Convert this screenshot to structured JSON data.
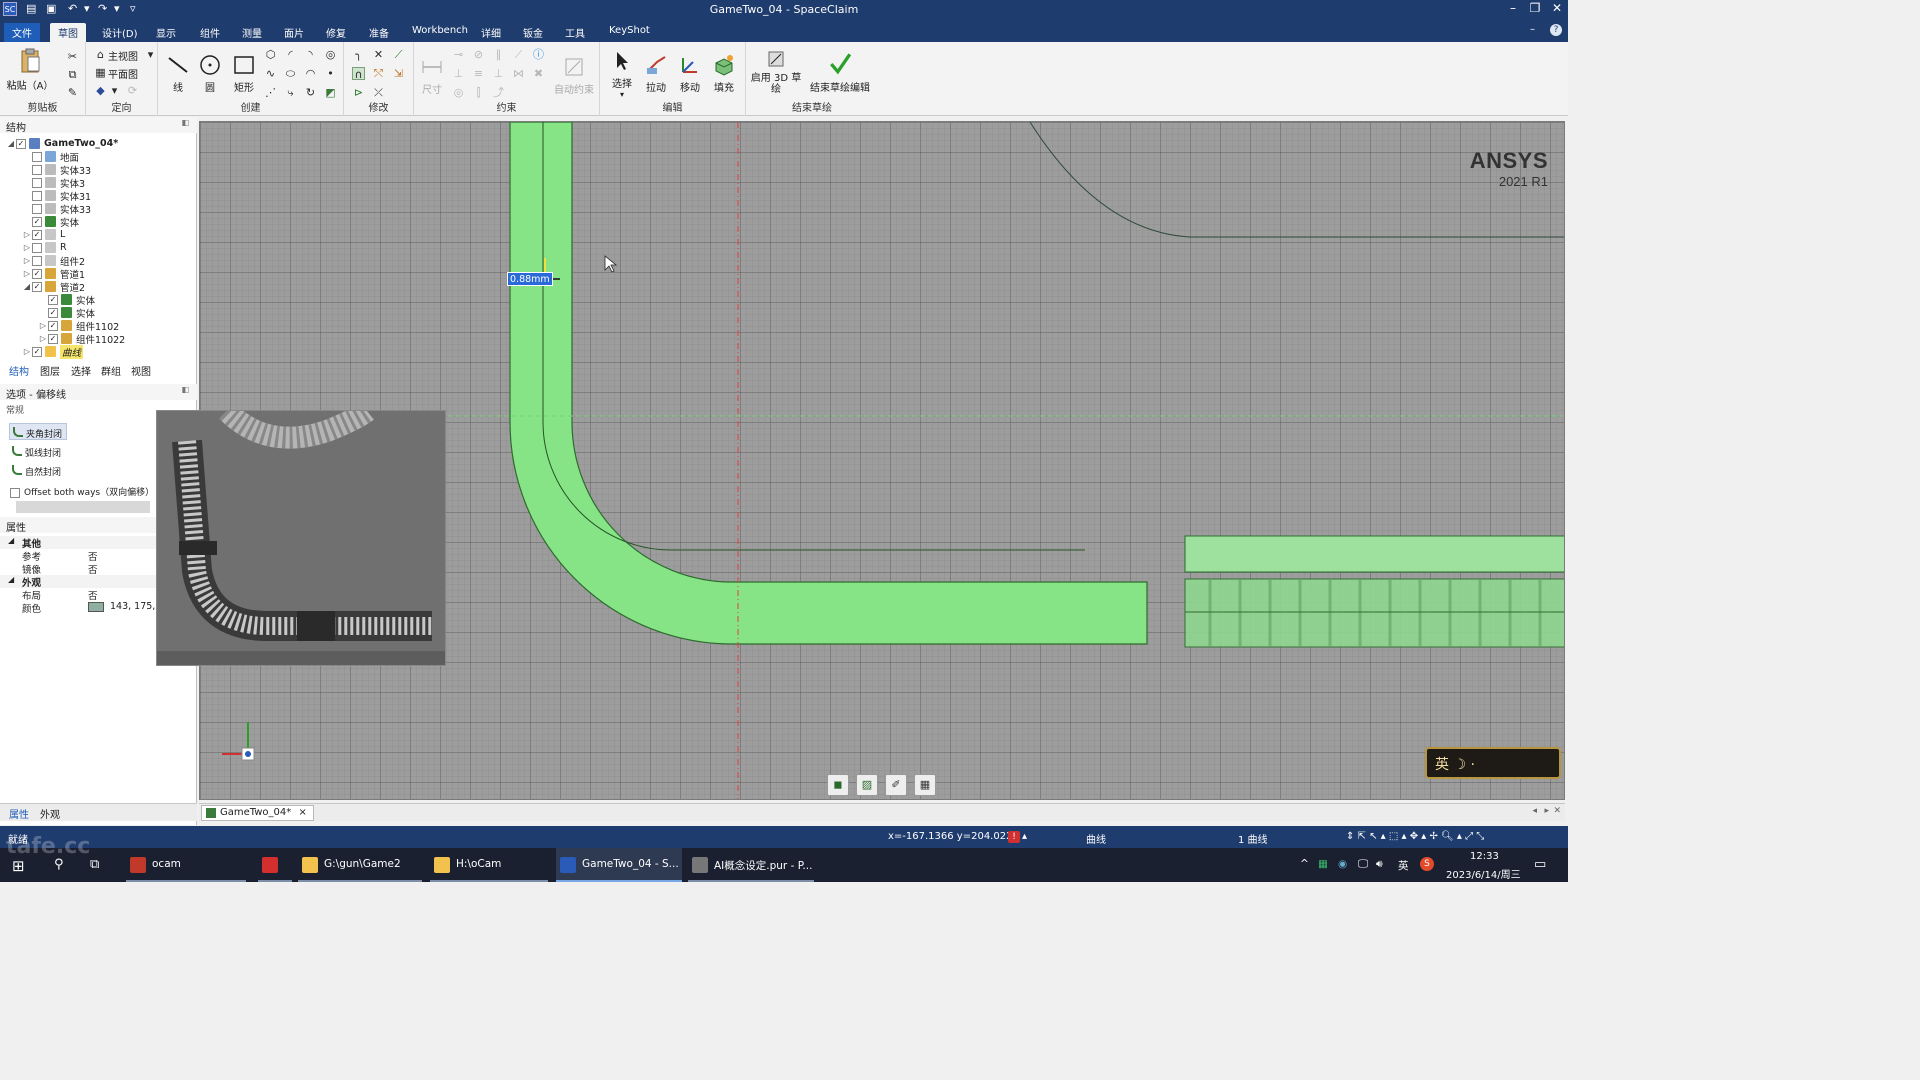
{
  "window": {
    "title": "GameTwo_04 - SpaceClaim",
    "app_icon": "SC",
    "controls": {
      "minimize": "–",
      "restore": "❐",
      "close": "✕"
    }
  },
  "menu_tabs": [
    "文件",
    "草图",
    "设计(D)",
    "显示",
    "组件",
    "测量",
    "面片",
    "修复",
    "准备",
    "Workbench",
    "详细",
    "钣金",
    "工具",
    "KeyShot"
  ],
  "ribbon": {
    "clipboard": {
      "paste": "粘贴（A）",
      "group": "剪贴板"
    },
    "orient": {
      "home_view": "主视图",
      "plan_view": "平面图",
      "group": "定向"
    },
    "create": {
      "line": "线",
      "circle": "圆",
      "rect": "矩形",
      "group": "创建"
    },
    "modify": {
      "group": "修改"
    },
    "constrain": {
      "dimension": "尺寸",
      "auto": "自动约束",
      "group": "约束"
    },
    "edit": {
      "select": "选择",
      "pull": "拉动",
      "move": "移动",
      "fill": "填充",
      "group": "编辑"
    },
    "end_sketch": {
      "enable_3d": "启用 3D 草绘",
      "finish": "结束草绘编辑",
      "group": "结束草绘"
    }
  },
  "structure": {
    "header": "结构",
    "tree": [
      {
        "label": "GameTwo_04*",
        "level": 0,
        "expander": "◢",
        "checked": true,
        "icon": "root-icon",
        "bold": true
      },
      {
        "label": "地面",
        "level": 1,
        "expander": "",
        "checked": false,
        "icon": "ground-icon"
      },
      {
        "label": "实体33",
        "level": 1,
        "expander": "",
        "checked": false,
        "icon": "solid-grey-icon"
      },
      {
        "label": "实体3",
        "level": 1,
        "expander": "",
        "checked": false,
        "icon": "solid-grey-icon"
      },
      {
        "label": "实体31",
        "level": 1,
        "expander": "",
        "checked": false,
        "icon": "solid-grey-icon"
      },
      {
        "label": "实体33",
        "level": 1,
        "expander": "",
        "checked": false,
        "icon": "solid-grey-icon"
      },
      {
        "label": "实体",
        "level": 1,
        "expander": "",
        "checked": true,
        "icon": "solid-icon"
      },
      {
        "label": "L",
        "level": 1,
        "expander": "▷",
        "checked": true,
        "icon": "component-grey-icon"
      },
      {
        "label": "R",
        "level": 1,
        "expander": "▷",
        "checked": false,
        "icon": "component-grey-icon"
      },
      {
        "label": "组件2",
        "level": 1,
        "expander": "▷",
        "checked": false,
        "icon": "component-grey-icon"
      },
      {
        "label": "管道1",
        "level": 1,
        "expander": "▷",
        "checked": true,
        "icon": "component-icon"
      },
      {
        "label": "管道2",
        "level": 1,
        "expander": "◢",
        "checked": true,
        "icon": "component-icon"
      },
      {
        "label": "实体",
        "level": 2,
        "expander": "",
        "checked": true,
        "icon": "solid-icon"
      },
      {
        "label": "实体",
        "level": 2,
        "expander": "",
        "checked": true,
        "icon": "solid-icon"
      },
      {
        "label": "组件1102",
        "level": 2,
        "expander": "▷",
        "checked": true,
        "icon": "component-icon"
      },
      {
        "label": "组件11022",
        "level": 2,
        "expander": "▷",
        "checked": true,
        "icon": "component-icon"
      },
      {
        "label": "曲线",
        "level": 1,
        "expander": "▷",
        "checked": true,
        "icon": "folder-icon",
        "highlight": true
      }
    ],
    "tabs": [
      "结构",
      "图层",
      "选择",
      "群组",
      "视图"
    ]
  },
  "options": {
    "header": "选项 - 偏移线",
    "section": "常规",
    "buttons": [
      "夹角封闭",
      "弧线封闭",
      "自然封闭"
    ],
    "checkbox_label": "Offset both ways（双向偏移）"
  },
  "properties": {
    "header": "属性",
    "rows": [
      {
        "key": "其他",
        "value": "",
        "category": true
      },
      {
        "key": "参考",
        "value": "否"
      },
      {
        "key": "镜像",
        "value": "否"
      },
      {
        "key": "外观",
        "value": "",
        "category": true
      },
      {
        "key": "布局",
        "value": "否"
      },
      {
        "key": "颜色",
        "value": "143, 175, 1",
        "swatch": "#8fafa0"
      }
    ],
    "bottom_tabs": [
      "属性",
      "外观"
    ]
  },
  "viewport": {
    "logo_line1": "ANSYS",
    "logo_line2": "2021 R1",
    "dimension_value": "0.88mm",
    "ime_badge": "英 ☽ ·",
    "accent_pipe": "#7fe07f",
    "accent_pipe_edge": "#2f6b2f"
  },
  "doc_tab": {
    "label": "GameTwo_04*",
    "close": "×"
  },
  "status": {
    "ready": "就绪",
    "coords": "x=-167.1366  y=204.0226",
    "mode": "曲线",
    "selection": "1 曲线"
  },
  "taskbar": {
    "items": [
      {
        "label": "ocam",
        "icon_color": "#c0392b"
      },
      {
        "label": "",
        "icon_color": "#d32f2f"
      },
      {
        "label": "G:\\gun\\Game2",
        "icon_color": "#f2c14e"
      },
      {
        "label": "H:\\oCam",
        "icon_color": "#f2c14e"
      },
      {
        "label": "GameTwo_04 - S...",
        "icon_color": "#2a5bb8"
      },
      {
        "label": "AI概念设定.pur - P...",
        "icon_color": "#777777"
      }
    ],
    "time": "12:33",
    "date": "2023/6/14/周三",
    "lang": "英"
  },
  "watermark": "tafe.cc"
}
